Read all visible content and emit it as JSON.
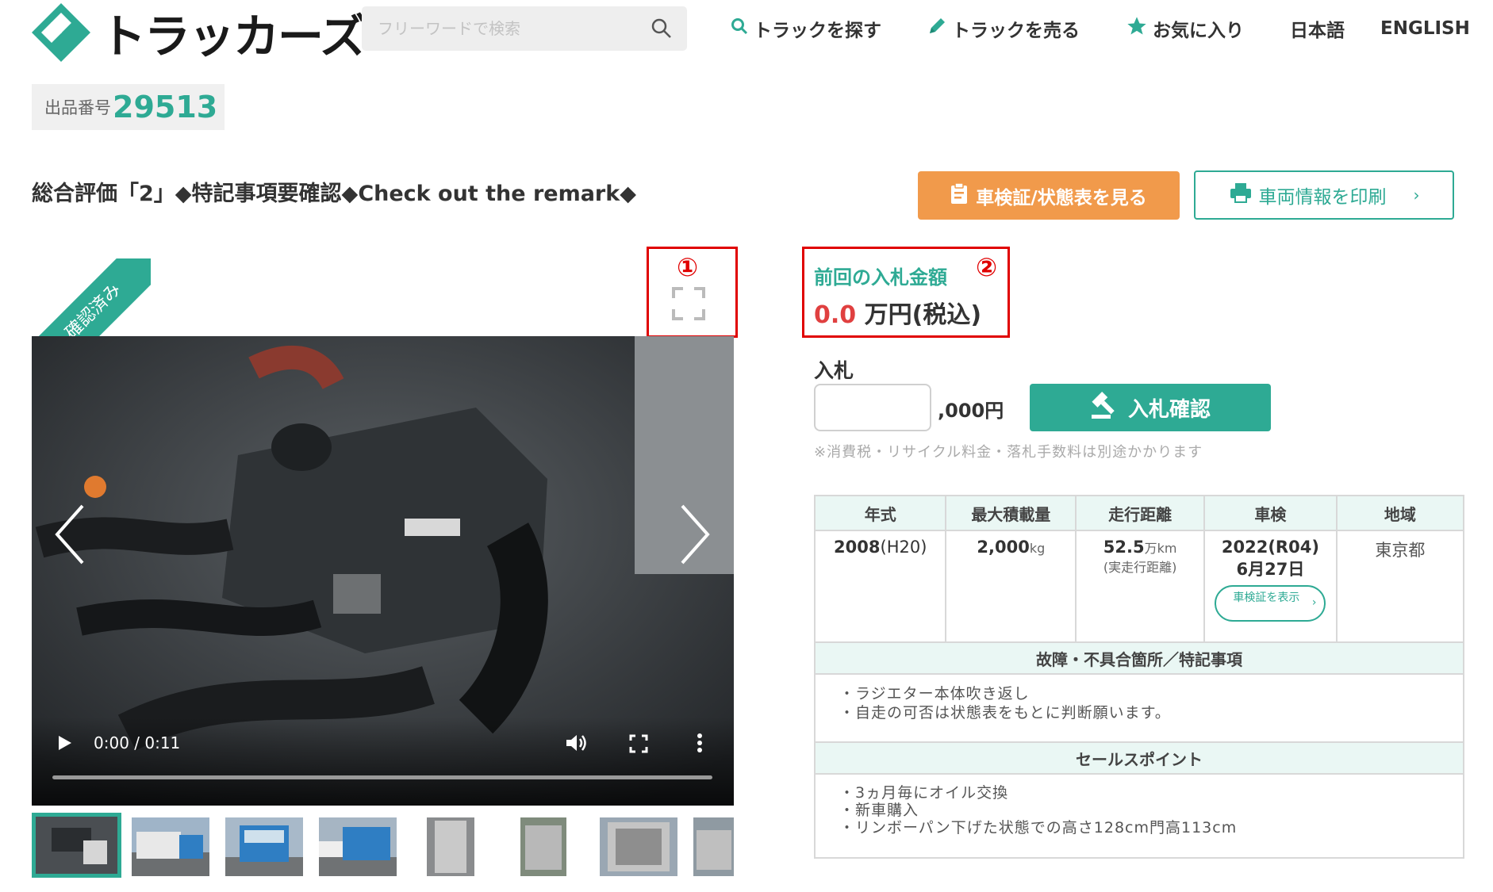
{
  "header": {
    "logo_text": "トラッカーズ",
    "search_placeholder": "フリーワードで検索",
    "nav": [
      {
        "label": "トラックを探す",
        "icon": "search-icon"
      },
      {
        "label": "トラックを売る",
        "icon": "pencil-icon"
      },
      {
        "label": "お気に入り",
        "icon": "star-icon"
      },
      {
        "label": "日本語"
      },
      {
        "label": "ENGLISH"
      }
    ]
  },
  "listing": {
    "lot_label": "出品番号",
    "lot_number": "29513",
    "title": "総合評価「2」◆特記事項要確認◆Check out the remark◆",
    "inspect_button": "車検証/状態表を見る",
    "print_button": "車両情報を印刷"
  },
  "media": {
    "verified_badge": "確認済み",
    "annotation_1": "①",
    "video_time": "0:00 / 0:11",
    "thumbnail_count": 8
  },
  "bid": {
    "annotation_2": "②",
    "prev_label": "前回の入札金額",
    "prev_amount": "0.0",
    "prev_unit": "万円(税込)",
    "bid_label": "入札",
    "bid_value": "",
    "bid_unit": ",000円",
    "confirm_button": "入札確認",
    "note": "※消費税・リサイクル料金・落札手数料は別途かかります"
  },
  "specs": {
    "headers": [
      "年式",
      "最大積載量",
      "走行距離",
      "車検",
      "地域"
    ],
    "year_main": "2008",
    "year_era": "(H20)",
    "capacity_value": "2,000",
    "capacity_unit": "kg",
    "mileage_value": "52.5",
    "mileage_unit": "万km",
    "mileage_note": "(実走行距離)",
    "inspection_year": "2022(R04)",
    "inspection_date": "6月27日",
    "inspection_link": "車検証を表示",
    "region": "東京都",
    "defects_title": "故障・不具合箇所／特記事項",
    "defects": [
      "・ラジエター本体吹き返し",
      "・自走の可否は状態表をもとに判断願います。"
    ],
    "sales_title": "セールスポイント",
    "sales_points": [
      "・3ヵ月毎にオイル交換",
      "・新車購入",
      "・リンボーパン下げた状態での高さ128cm門高113cm"
    ]
  },
  "colors": {
    "accent": "#2eaa94",
    "orange": "#f19a4b",
    "annotation_red": "#e00000",
    "price_red": "#e04040"
  }
}
